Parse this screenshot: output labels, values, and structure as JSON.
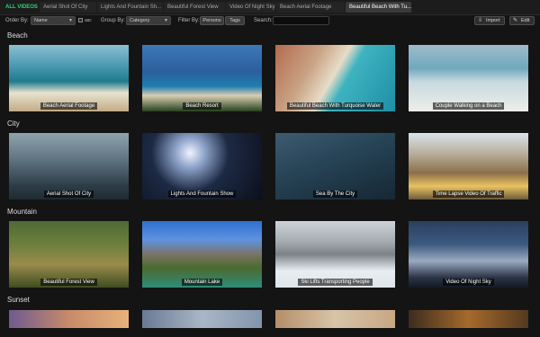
{
  "tabs": [
    {
      "label": "ALL VIDEOS"
    },
    {
      "label": "Aerial Shot Of City"
    },
    {
      "label": "Lights And Fountain Sh..."
    },
    {
      "label": "Beautiful Forest View"
    },
    {
      "label": "Video Of Night Sky"
    },
    {
      "label": "Beach Aerial Footage"
    },
    {
      "label": "Beautiful Beach With Tu..."
    }
  ],
  "toolbar": {
    "order_by_label": "Order By:",
    "order_by_value": "Name",
    "asc_label": "asc",
    "group_by_label": "Group By:",
    "group_by_value": "Category",
    "filter_by_label": "Filter By:",
    "filter_persons": "Persons",
    "filter_tags": "Tags",
    "search_label": "Search:",
    "search_value": "",
    "import_label": "Import",
    "edit_label": "Edit"
  },
  "groups": [
    {
      "title": "Beach",
      "items": [
        {
          "caption": "Beach Aerial Footage"
        },
        {
          "caption": "Beach Resort"
        },
        {
          "caption": "Beautiful Beach With Turquoise Water"
        },
        {
          "caption": "Couple Walking on a Beach"
        }
      ]
    },
    {
      "title": "City",
      "items": [
        {
          "caption": "Aerial Shot Of City"
        },
        {
          "caption": "Lights And Fountain Show"
        },
        {
          "caption": "Sea By The City"
        },
        {
          "caption": "Time Lapse Video Of Traffic"
        }
      ]
    },
    {
      "title": "Mountain",
      "items": [
        {
          "caption": "Beautiful Forest View"
        },
        {
          "caption": "Mountain Lake"
        },
        {
          "caption": "Ski Lifts Transporting People"
        },
        {
          "caption": "Video Of Night Sky"
        }
      ]
    },
    {
      "title": "Sunset",
      "items": [
        {
          "caption": ""
        },
        {
          "caption": ""
        },
        {
          "caption": ""
        },
        {
          "caption": ""
        }
      ]
    }
  ]
}
